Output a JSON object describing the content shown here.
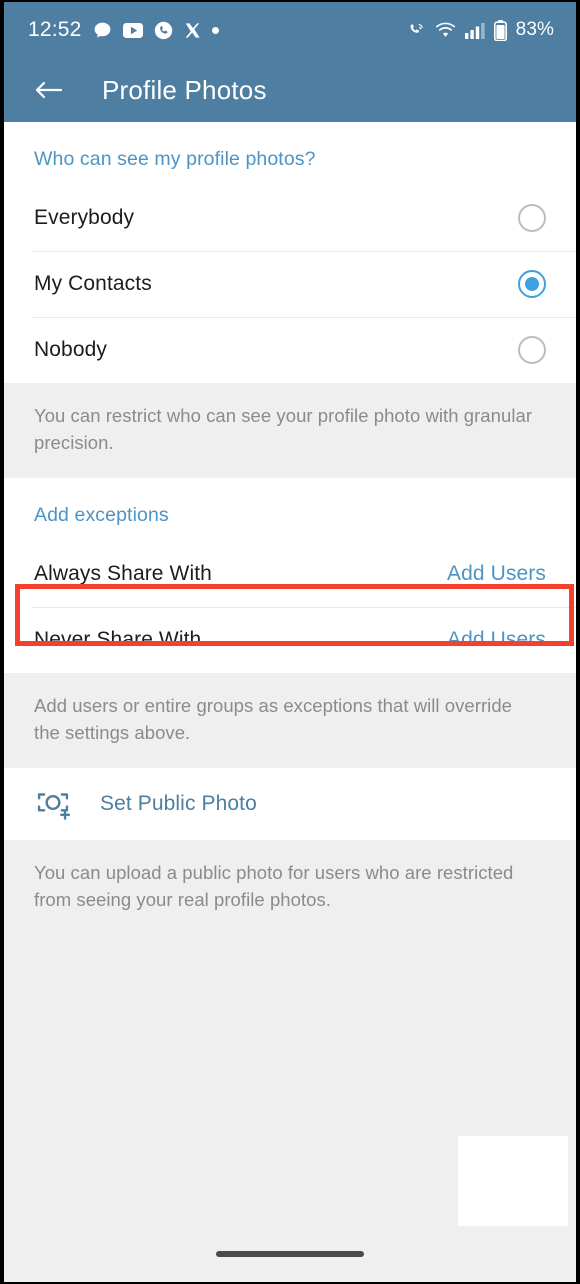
{
  "statusbar": {
    "time": "12:52",
    "battery_percent": "83%",
    "left_icons": [
      "messages-bubble-icon",
      "youtube-icon",
      "phone-circle-icon",
      "x-twitter-icon",
      "more-dot-icon"
    ],
    "right_icons": [
      "call-wifi-icon",
      "wifi-icon",
      "cellular-signal-icon",
      "battery-icon"
    ]
  },
  "appbar": {
    "title": "Profile Photos",
    "back_icon": "arrow-left-icon"
  },
  "visibility": {
    "section_title": "Who can see my profile photos?",
    "options": [
      {
        "label": "Everybody",
        "selected": false
      },
      {
        "label": "My Contacts",
        "selected": true
      },
      {
        "label": "Nobody",
        "selected": false
      }
    ],
    "note": "You can restrict who can see your profile photo with granular precision."
  },
  "exceptions": {
    "section_title": "Add exceptions",
    "rows": [
      {
        "label": "Always Share With",
        "action": "Add Users",
        "highlighted": false
      },
      {
        "label": "Never Share With",
        "action": "Add Users",
        "highlighted": true
      }
    ],
    "note": "Add users or entire groups as exceptions that will override the settings above."
  },
  "public_photo": {
    "icon": "camera-plus-icon",
    "label": "Set Public Photo",
    "note": "You can upload a public photo for users who are restricted from seeing your real profile photos."
  },
  "navbar": {
    "gesture_pill": "home-gesture-pill"
  },
  "colors": {
    "header_blue": "#4e7ea2",
    "accent_blue": "#4e94c4",
    "radio_selected": "#3fa0e0",
    "highlight_red": "#f4402c",
    "band_gray": "#efefef",
    "note_text": "#8b8b8b"
  }
}
